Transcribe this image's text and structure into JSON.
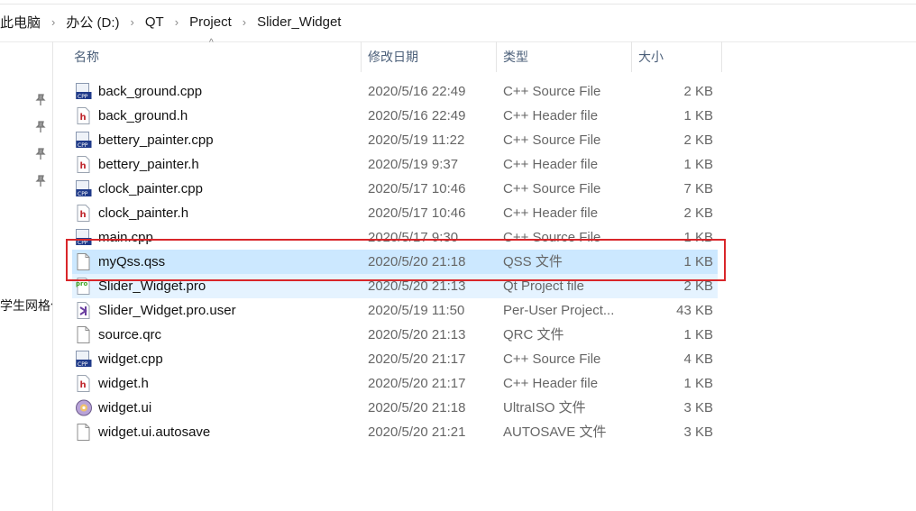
{
  "breadcrumb": [
    "此电脑",
    "办公 (D:)",
    "QT",
    "Project",
    "Slider_Widget"
  ],
  "breadcrumb_sep": "›",
  "nav_partial_text": "学生网格化",
  "columns": {
    "name": "名称",
    "date": "修改日期",
    "type": "类型",
    "size": "大小"
  },
  "sort_indicator": "^",
  "files": [
    {
      "name": "back_ground.cpp",
      "date": "2020/5/16 22:49",
      "type": "C++ Source File",
      "size": "2 KB",
      "icon": "cpp-file-icon",
      "state": ""
    },
    {
      "name": "back_ground.h",
      "date": "2020/5/16 22:49",
      "type": "C++ Header file",
      "size": "1 KB",
      "icon": "header-file-icon",
      "state": ""
    },
    {
      "name": "bettery_painter.cpp",
      "date": "2020/5/19 11:22",
      "type": "C++ Source File",
      "size": "2 KB",
      "icon": "cpp-file-icon",
      "state": ""
    },
    {
      "name": "bettery_painter.h",
      "date": "2020/5/19 9:37",
      "type": "C++ Header file",
      "size": "1 KB",
      "icon": "header-file-icon",
      "state": ""
    },
    {
      "name": "clock_painter.cpp",
      "date": "2020/5/17 10:46",
      "type": "C++ Source File",
      "size": "7 KB",
      "icon": "cpp-file-icon",
      "state": ""
    },
    {
      "name": "clock_painter.h",
      "date": "2020/5/17 10:46",
      "type": "C++ Header file",
      "size": "2 KB",
      "icon": "header-file-icon",
      "state": ""
    },
    {
      "name": "main.cpp",
      "date": "2020/5/17 9:30",
      "type": "C++ Source File",
      "size": "1 KB",
      "icon": "cpp-file-icon",
      "state": ""
    },
    {
      "name": "myQss.qss",
      "date": "2020/5/20 21:18",
      "type": "QSS 文件",
      "size": "1 KB",
      "icon": "blank-file-icon",
      "state": "selected"
    },
    {
      "name": "Slider_Widget.pro",
      "date": "2020/5/20 21:13",
      "type": "Qt Project file",
      "size": "2 KB",
      "icon": "qt-project-icon",
      "state": "dim"
    },
    {
      "name": "Slider_Widget.pro.user",
      "date": "2020/5/19 11:50",
      "type": "Per-User Project...",
      "size": "43 KB",
      "icon": "visual-studio-icon",
      "state": ""
    },
    {
      "name": "source.qrc",
      "date": "2020/5/20 21:13",
      "type": "QRC 文件",
      "size": "1 KB",
      "icon": "blank-file-icon",
      "state": ""
    },
    {
      "name": "widget.cpp",
      "date": "2020/5/20 21:17",
      "type": "C++ Source File",
      "size": "4 KB",
      "icon": "cpp-file-icon",
      "state": ""
    },
    {
      "name": "widget.h",
      "date": "2020/5/20 21:17",
      "type": "C++ Header file",
      "size": "1 KB",
      "icon": "header-file-icon",
      "state": ""
    },
    {
      "name": "widget.ui",
      "date": "2020/5/20 21:18",
      "type": "UltraISO 文件",
      "size": "3 KB",
      "icon": "disc-image-icon",
      "state": ""
    },
    {
      "name": "widget.ui.autosave",
      "date": "2020/5/20 21:21",
      "type": "AUTOSAVE 文件",
      "size": "3 KB",
      "icon": "blank-file-icon",
      "state": ""
    }
  ],
  "colors": {
    "selected_row": "#cce8ff",
    "hover_row": "#e5f3ff",
    "highlight_box": "#d9262a",
    "header_text": "#4c607a"
  }
}
